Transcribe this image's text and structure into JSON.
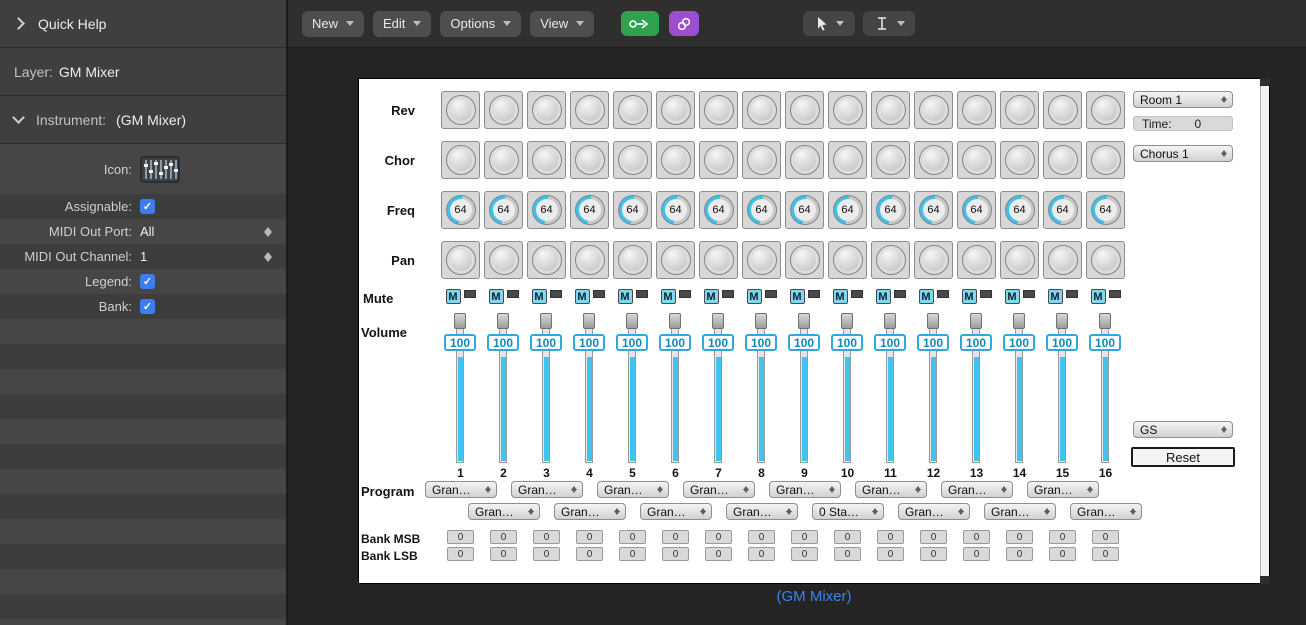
{
  "sidebar": {
    "quick_help_label": "Quick Help",
    "layer": {
      "label": "Layer:",
      "value": "GM Mixer"
    },
    "instrument": {
      "label": "Instrument:",
      "value": "(GM Mixer)"
    },
    "icon_row": {
      "label": "Icon:"
    },
    "assignable": {
      "label": "Assignable:",
      "checked": true
    },
    "midi_out_port": {
      "label": "MIDI Out Port:",
      "value": "All"
    },
    "midi_out_channel": {
      "label": "MIDI Out Channel:",
      "value": "1"
    },
    "legend": {
      "label": "Legend:",
      "checked": true
    },
    "bank": {
      "label": "Bank:",
      "checked": true
    }
  },
  "toolbar": {
    "menus": [
      {
        "label": "New"
      },
      {
        "label": "Edit"
      },
      {
        "label": "Options"
      },
      {
        "label": "View"
      }
    ]
  },
  "icons": {
    "disclosure_right": "chevron-right-icon",
    "disclosure_down": "chevron-down-icon",
    "cable": "cable-icon",
    "link": "link-icon",
    "pointer": "pointer-cursor-icon",
    "ibeam": "ibeam-cursor-icon",
    "updown": "updown-arrows-icon"
  },
  "colors": {
    "accent_cyan": "#41c3ef",
    "caption_blue": "#3b82f7",
    "checkbox_blue": "#3d7df0",
    "toolbar_green": "#2ea24e",
    "toolbar_purple": "#9b4fd0"
  },
  "mixer": {
    "row_labels": {
      "rev": "Rev",
      "chor": "Chor",
      "freq": "Freq",
      "pan": "Pan",
      "mute": "Mute",
      "volume": "Volume",
      "program": "Program",
      "bank_msb": "Bank MSB",
      "bank_lsb": "Bank LSB"
    },
    "mute_label": "M",
    "freq_values": [
      "64",
      "64",
      "64",
      "64",
      "64",
      "64",
      "64",
      "64",
      "64",
      "64",
      "64",
      "64",
      "64",
      "64",
      "64",
      "64"
    ],
    "volume_values": [
      "100",
      "100",
      "100",
      "100",
      "100",
      "100",
      "100",
      "100",
      "100",
      "100",
      "100",
      "100",
      "100",
      "100",
      "100",
      "100"
    ],
    "channel_numbers": [
      "1",
      "2",
      "3",
      "4",
      "5",
      "6",
      "7",
      "8",
      "9",
      "10",
      "11",
      "12",
      "13",
      "14",
      "15",
      "16"
    ],
    "programs_row1": [
      "Gran…",
      "Gran…",
      "Gran…",
      "Gran…",
      "Gran…",
      "Gran…",
      "Gran…",
      "Gran…"
    ],
    "programs_row2": [
      "Gran…",
      "Gran…",
      "Gran…",
      "Gran…",
      "0 Sta…",
      "Gran…",
      "Gran…",
      "Gran…"
    ],
    "bank_msb_values": [
      "0",
      "0",
      "0",
      "0",
      "0",
      "0",
      "0",
      "0",
      "0",
      "0",
      "0",
      "0",
      "0",
      "0",
      "0",
      "0"
    ],
    "bank_lsb_values": [
      "0",
      "0",
      "0",
      "0",
      "0",
      "0",
      "0",
      "0",
      "0",
      "0",
      "0",
      "0",
      "0",
      "0",
      "0",
      "0"
    ],
    "right_panel": {
      "reverb": "Room 1",
      "time_label": "Time:",
      "time_value": "0",
      "chorus": "Chorus 1",
      "bank_mode": "GS",
      "reset": "Reset"
    }
  },
  "caption": "(GM Mixer)"
}
